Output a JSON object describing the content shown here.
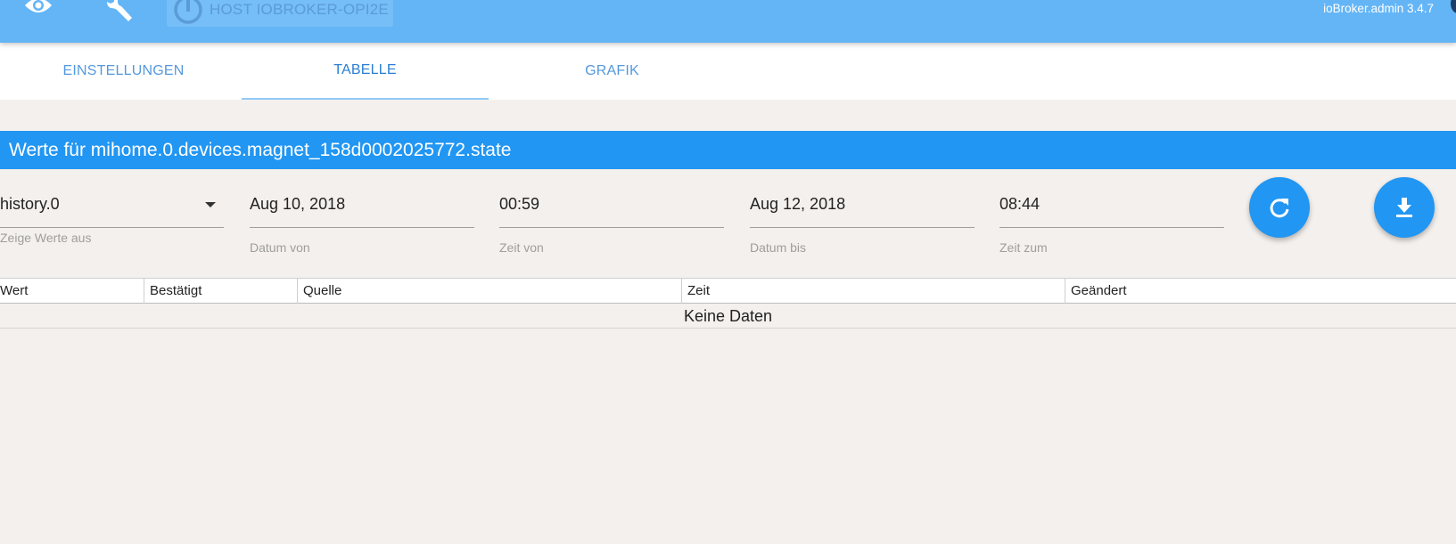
{
  "header": {
    "host_label": "HOST IOBROKER-OPI2E",
    "version": "ioBroker.admin 3.4.7",
    "icons": [
      "eye-icon",
      "wrench-icon",
      "power-icon"
    ],
    "colors": {
      "appbar": "#64b5f6",
      "accent": "#2196f3"
    }
  },
  "tabs": [
    {
      "label": "EINSTELLUNGEN",
      "active": false
    },
    {
      "label": "TABELLE",
      "active": true
    },
    {
      "label": "GRAFIK",
      "active": false
    }
  ],
  "section": {
    "title": "Werte für mihome.0.devices.magnet_158d0002025772.state"
  },
  "filters": {
    "instance": {
      "value": "history.0",
      "label": "Zeige Werte aus"
    },
    "date_from": {
      "value": "Aug 10, 2018",
      "label": "Datum von"
    },
    "time_from": {
      "value": "00:59",
      "label": "Zeit von"
    },
    "date_to": {
      "value": "Aug 12, 2018",
      "label": "Datum bis"
    },
    "time_to": {
      "value": "08:44",
      "label": "Zeit zum"
    }
  },
  "actions": {
    "refresh_icon": "refresh-icon",
    "download_icon": "download-icon"
  },
  "table": {
    "columns": [
      "Wert",
      "Bestätigt",
      "Quelle",
      "Zeit",
      "Geändert"
    ],
    "empty_text": "Keine Daten"
  }
}
